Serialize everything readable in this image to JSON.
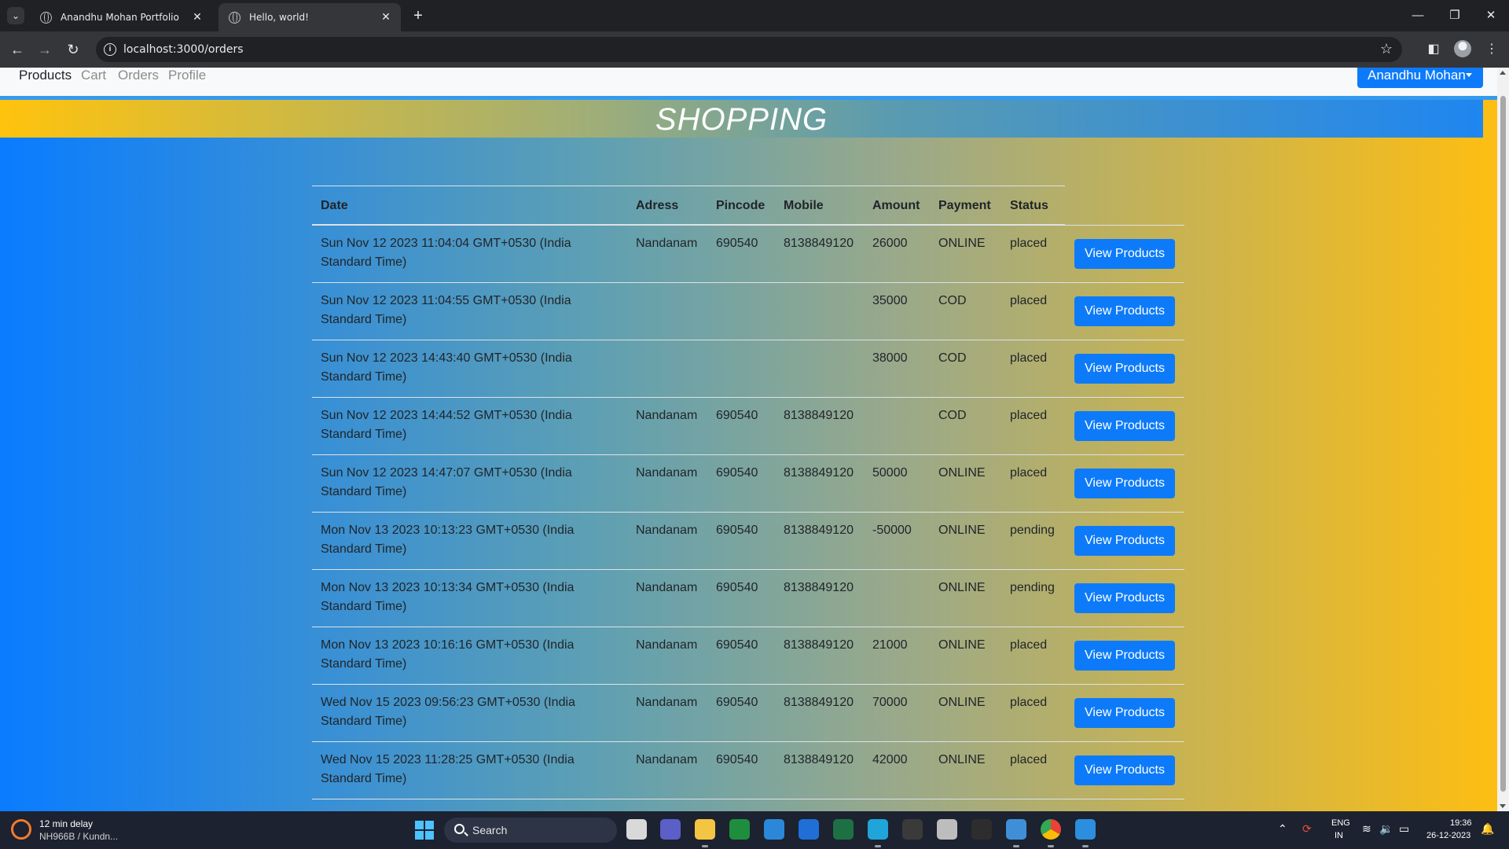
{
  "browser": {
    "tabs": [
      {
        "title": "Anandhu Mohan Portfolio"
      },
      {
        "title": "Hello, world!"
      }
    ],
    "url": "localhost:3000/orders"
  },
  "nav": {
    "links": [
      "Products",
      "Cart",
      "Orders",
      "Profile"
    ],
    "user": "Anandhu Mohan"
  },
  "hero": {
    "title": "SHOPPING"
  },
  "table": {
    "headers": [
      "Date",
      "Adress",
      "Pincode",
      "Mobile",
      "Amount",
      "Payment",
      "Status"
    ],
    "action_label": "View Products",
    "rows": [
      {
        "date1": "Sun Nov 12 2023 11:04:04 GMT+0530 (India",
        "date2": "Standard Time)",
        "address": "Nandanam",
        "pincode": "690540",
        "mobile": "8138849120",
        "amount": "26000",
        "payment": "ONLINE",
        "status": "placed"
      },
      {
        "date1": "Sun Nov 12 2023 11:04:55 GMT+0530 (India",
        "date2": "Standard Time)",
        "address": "",
        "pincode": "",
        "mobile": "",
        "amount": "35000",
        "payment": "COD",
        "status": "placed"
      },
      {
        "date1": "Sun Nov 12 2023 14:43:40 GMT+0530 (India",
        "date2": "Standard Time)",
        "address": "",
        "pincode": "",
        "mobile": "",
        "amount": "38000",
        "payment": "COD",
        "status": "placed"
      },
      {
        "date1": "Sun Nov 12 2023 14:44:52 GMT+0530 (India",
        "date2": "Standard Time)",
        "address": "Nandanam",
        "pincode": "690540",
        "mobile": "8138849120",
        "amount": "",
        "payment": "COD",
        "status": "placed"
      },
      {
        "date1": "Sun Nov 12 2023 14:47:07 GMT+0530 (India",
        "date2": "Standard Time)",
        "address": "Nandanam",
        "pincode": "690540",
        "mobile": "8138849120",
        "amount": "50000",
        "payment": "ONLINE",
        "status": "placed"
      },
      {
        "date1": "Mon Nov 13 2023 10:13:23 GMT+0530 (India",
        "date2": "Standard Time)",
        "address": "Nandanam",
        "pincode": "690540",
        "mobile": "8138849120",
        "amount": "-50000",
        "payment": "ONLINE",
        "status": "pending"
      },
      {
        "date1": "Mon Nov 13 2023 10:13:34 GMT+0530 (India",
        "date2": "Standard Time)",
        "address": "Nandanam",
        "pincode": "690540",
        "mobile": "8138849120",
        "amount": "",
        "payment": "ONLINE",
        "status": "pending"
      },
      {
        "date1": "Mon Nov 13 2023 10:16:16 GMT+0530 (India",
        "date2": "Standard Time)",
        "address": "Nandanam",
        "pincode": "690540",
        "mobile": "8138849120",
        "amount": "21000",
        "payment": "ONLINE",
        "status": "placed"
      },
      {
        "date1": "Wed Nov 15 2023 09:56:23 GMT+0530 (India",
        "date2": "Standard Time)",
        "address": "Nandanam",
        "pincode": "690540",
        "mobile": "8138849120",
        "amount": "70000",
        "payment": "ONLINE",
        "status": "placed"
      },
      {
        "date1": "Wed Nov 15 2023 11:28:25 GMT+0530 (India",
        "date2": "Standard Time)",
        "address": "Nandanam",
        "pincode": "690540",
        "mobile": "8138849120",
        "amount": "42000",
        "payment": "ONLINE",
        "status": "placed"
      }
    ]
  },
  "taskbar": {
    "weather_line1": "12 min delay",
    "weather_line2": "NH966B / Kundn...",
    "search_label": "Search",
    "lang1": "ENG",
    "lang2": "IN",
    "time": "19:36",
    "date": "26-12-2023",
    "apps": [
      "task-view-icon",
      "teams-icon",
      "file-explorer-icon",
      "classroom-icon",
      "mail-icon",
      "store-icon",
      "excel-icon",
      "edge-icon",
      "terminal-icon",
      "settings-icon",
      "cmd-icon",
      "notepad-icon",
      "chrome-icon",
      "vscode-icon"
    ]
  },
  "colors": {
    "primary": "#0d7bf9",
    "gradient_left": "#0a7cff",
    "gradient_right": "#fdbe12"
  }
}
